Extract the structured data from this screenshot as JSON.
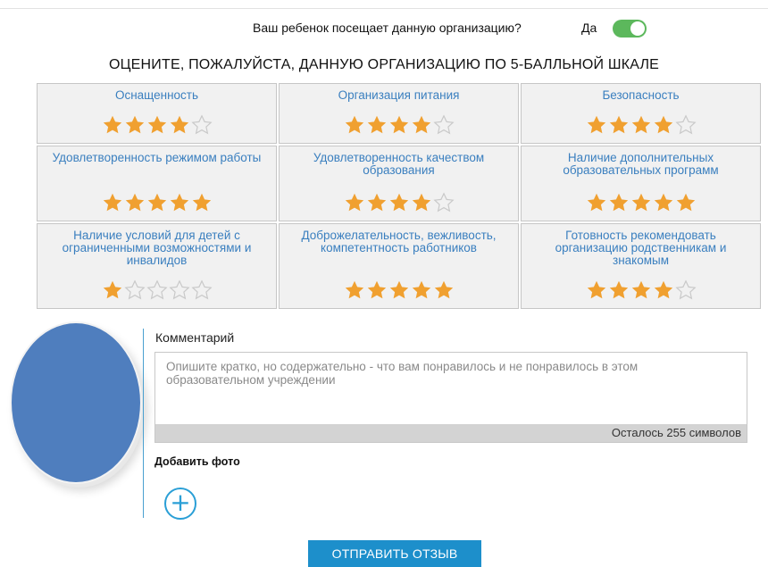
{
  "question": {
    "text": "Ваш ребенок посещает данную организацию?",
    "answer": "Да",
    "toggle_on": true
  },
  "heading": "ОЦЕНИТЕ, ПОЖАЛУЙСТА, ДАННУЮ ОРГАНИЗАЦИЮ ПО 5-БАЛЛЬНОЙ ШКАЛЕ",
  "rating_max": 5,
  "ratings": [
    {
      "label": "Оснащенность",
      "value": 4
    },
    {
      "label": "Организация питания",
      "value": 4
    },
    {
      "label": "Безопасность",
      "value": 4
    },
    {
      "label": "Удовлетворенность режимом работы",
      "value": 5
    },
    {
      "label": "Удовлетворенность качеством образования",
      "value": 4
    },
    {
      "label": "Наличие дополнительных образовательных программ",
      "value": 5
    },
    {
      "label": "Наличие условий для детей с ограниченными возможностями и инвалидов",
      "value": 1
    },
    {
      "label": "Доброжелательность, вежливость, компетентность работников",
      "value": 5
    },
    {
      "label": "Готовность рекомендовать организацию родственникам и знакомым",
      "value": 4
    }
  ],
  "comment": {
    "label": "Комментарий",
    "placeholder": "Опишите кратко, но содержательно - что вам понравилось и не понравилось в этом образовательном учреждении",
    "value": "",
    "counter": "Осталось 255 символов"
  },
  "photo": {
    "label": "Добавить фото",
    "add_icon": "plus-circle-icon"
  },
  "submit_label": "ОТПРАВИТЬ ОТЗЫВ",
  "colors": {
    "star_filled": "#f0a030",
    "star_empty": "#c9c9c9",
    "link": "#3a7fbf",
    "accent": "#1d8fcb",
    "toggle_on": "#5cb85c"
  }
}
